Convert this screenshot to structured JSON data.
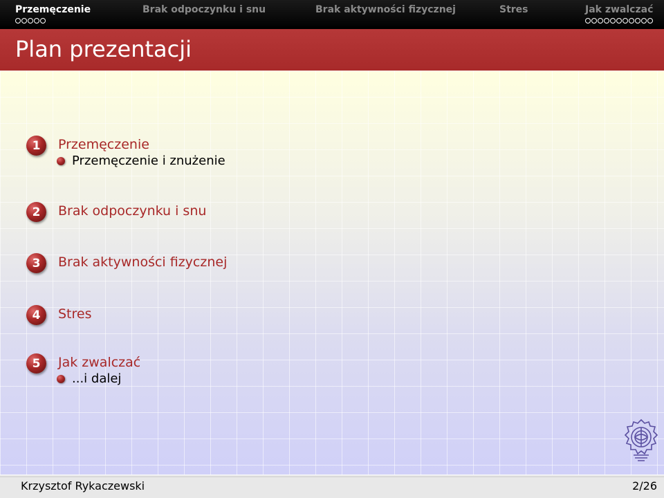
{
  "nav": {
    "sections": [
      {
        "label": "Przemęczenie",
        "dots": 5,
        "active": true
      },
      {
        "label": "Brak odpoczynku i snu",
        "dots": 0,
        "active": false
      },
      {
        "label": "Brak aktywności fizycznej",
        "dots": 0,
        "active": false
      },
      {
        "label": "Stres",
        "dots": 0,
        "active": false
      },
      {
        "label": "Jak zwalczać",
        "dots": 11,
        "active": false
      }
    ]
  },
  "frame_title": "Plan prezentacji",
  "toc": [
    {
      "number": "1",
      "title": "Przemęczenie",
      "subitems": [
        "Przemęczenie i znużenie"
      ]
    },
    {
      "number": "2",
      "title": "Brak odpoczynku i snu",
      "subitems": []
    },
    {
      "number": "3",
      "title": "Brak aktywności fizycznej",
      "subitems": []
    },
    {
      "number": "4",
      "title": "Stres",
      "subitems": []
    },
    {
      "number": "5",
      "title": "Jak zwalczać",
      "subitems": [
        "...i dalej"
      ]
    }
  ],
  "footer": {
    "author": "Krzysztof Rykaczewski",
    "page": "2/26"
  },
  "colors": {
    "accent": "#a82828",
    "nav_bg": "#000000",
    "titlebar_bg": "#b23434"
  }
}
